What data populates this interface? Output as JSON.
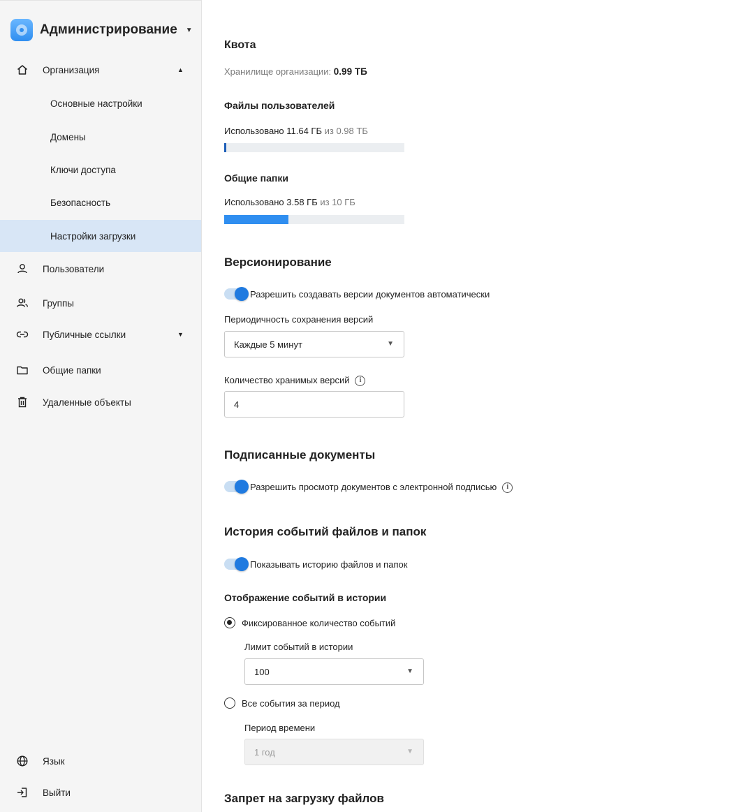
{
  "sidebar": {
    "app_title": "Администрирование",
    "org": {
      "label": "Организация"
    },
    "sub_items": [
      {
        "label": "Основные настройки"
      },
      {
        "label": "Домены"
      },
      {
        "label": "Ключи доступа"
      },
      {
        "label": "Безопасность"
      },
      {
        "label": "Настройки загрузки"
      }
    ],
    "items": [
      {
        "label": "Пользователи",
        "icon": "user-icon"
      },
      {
        "label": "Группы",
        "icon": "users-icon"
      },
      {
        "label": "Публичные ссылки",
        "icon": "link-icon"
      },
      {
        "label": "Общие папки",
        "icon": "folder-icon"
      },
      {
        "label": "Удаленные объекты",
        "icon": "trash-icon"
      }
    ],
    "bottom": [
      {
        "label": "Язык",
        "icon": "globe-icon"
      },
      {
        "label": "Выйти",
        "icon": "logout-icon"
      }
    ]
  },
  "quota": {
    "title": "Квота",
    "storage_label": "Хранилище организации:",
    "storage_value": "0.99 ТБ",
    "user_files": {
      "title": "Файлы пользователей",
      "used_label": "Использовано 11.64 ГБ",
      "of_label": "из 0.98 ТБ",
      "progress": 0.012
    },
    "shared": {
      "title": "Общие папки",
      "used_label": "Использовано 3.58 ГБ",
      "of_label": "из 10 ГБ",
      "progress": 0.358
    }
  },
  "versioning": {
    "title": "Версионирование",
    "toggle_label": "Разрешить создавать версии документов автоматически",
    "toggle_on": true,
    "period_label": "Периодичность сохранения версий",
    "period_value": "Каждые 5 минут",
    "count_label": "Количество хранимых версий",
    "count_value": "4"
  },
  "signed": {
    "title": "Подписанные документы",
    "toggle_label": "Разрешить просмотр документов с электронной подписью",
    "toggle_on": true
  },
  "history": {
    "title": "История событий файлов и папок",
    "toggle_label": "Показывать историю файлов и папок",
    "toggle_on": true,
    "display_title": "Отображение событий в истории",
    "fixed_label": "Фиксированное количество событий",
    "limit_label": "Лимит событий в истории",
    "limit_value": "100",
    "period_option_label": "Все события за период",
    "period_label": "Период времени",
    "period_value": "1 год",
    "selected": "fixed"
  },
  "upload_ban": {
    "title": "Запрет на загрузку файлов"
  },
  "colors": {
    "accent": "#1f7ae0",
    "active_nav": "#d8e6f6",
    "sidebar_bg": "#f5f5f5"
  }
}
